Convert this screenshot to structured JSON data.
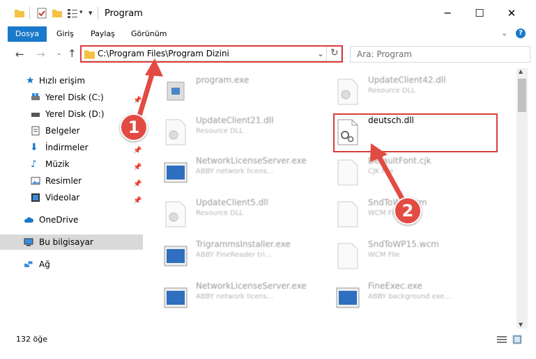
{
  "window": {
    "title": "Program",
    "minimize": "─",
    "maximize": "☐",
    "close": "✕"
  },
  "ribbon": {
    "tabs": [
      "Dosya",
      "Giriş",
      "Paylaş",
      "Görünüm"
    ]
  },
  "address": {
    "path": "C:\\Program Files\\Program Dizini",
    "search_placeholder": "Ara: Program"
  },
  "nav": {
    "quick_access": "Hızlı erişim",
    "items": [
      "Yerel Disk (C:)",
      "Yerel Disk (D:)",
      "Belgeler",
      "İndirmeler",
      "Müzik",
      "Resimler",
      "Videolar"
    ],
    "onedrive": "OneDrive",
    "this_pc": "Bu bilgisayar",
    "network": "Ağ"
  },
  "files": [
    {
      "name": "program.exe",
      "desc": ""
    },
    {
      "name": "UpdateClient42.dll",
      "desc": "Resource DLL"
    },
    {
      "name": "UpdateClient21.dll",
      "desc": "Resource DLL"
    },
    {
      "name": "deutsch.dll",
      "desc": ""
    },
    {
      "name": "NetworkLicenseServer.exe",
      "desc": "ABBY network licens..."
    },
    {
      "name": "DefaultFont.cjk",
      "desc": "CJK File"
    },
    {
      "name": "UpdateClient5.dll",
      "desc": "Resource DLL"
    },
    {
      "name": "SndToWP.wcm",
      "desc": "WCM File"
    },
    {
      "name": "TrigrammsInstaller.exe",
      "desc": "ABBY FineReader tri..."
    },
    {
      "name": "SndToWP15.wcm",
      "desc": "WCM File"
    },
    {
      "name": "NetworkLicenseServer.exe",
      "desc": "ABBY network licens..."
    },
    {
      "name": "FineExec.exe",
      "desc": "ABBY background exe..."
    }
  ],
  "status": {
    "count": "132 öğe"
  },
  "callouts": [
    "1",
    "2"
  ],
  "colors": {
    "accent": "#1979ca",
    "highlight": "#dc3c3c",
    "callout": "#e24b43"
  }
}
